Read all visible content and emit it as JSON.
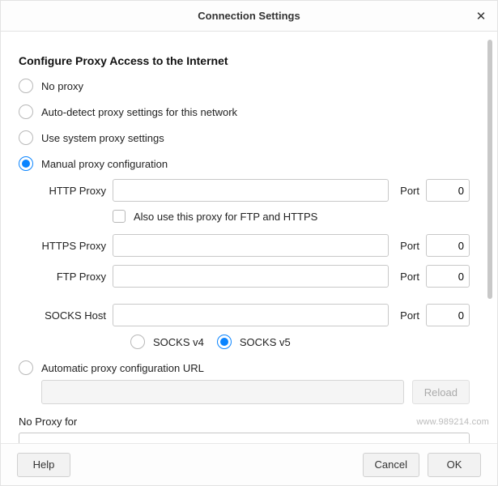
{
  "dialog": {
    "title": "Connection Settings",
    "close_glyph": "✕"
  },
  "heading": "Configure Proxy Access to the Internet",
  "proxy_mode": "manual",
  "options": {
    "no_proxy": "No proxy",
    "auto_detect": "Auto-detect proxy settings for this network",
    "system": "Use system proxy settings",
    "manual": "Manual proxy configuration",
    "auto_url": "Automatic proxy configuration URL"
  },
  "manual": {
    "http": {
      "label": "HTTP Proxy",
      "host": "",
      "port_label": "Port",
      "port": "0"
    },
    "shared_checkbox": {
      "checked": false,
      "label": "Also use this proxy for FTP and HTTPS"
    },
    "https": {
      "label": "HTTPS Proxy",
      "host": "",
      "port_label": "Port",
      "port": "0"
    },
    "ftp": {
      "label": "FTP Proxy",
      "host": "",
      "port_label": "Port",
      "port": "0"
    },
    "socks": {
      "label": "SOCKS Host",
      "host": "",
      "port_label": "Port",
      "port": "0"
    },
    "socks_version": {
      "selected": "v5",
      "v4_label": "SOCKS v4",
      "v5_label": "SOCKS v5"
    }
  },
  "auto_url": {
    "value": "",
    "reload_label": "Reload",
    "reload_enabled": false
  },
  "no_proxy_for": {
    "label": "No Proxy for",
    "value": ""
  },
  "footer": {
    "help": "Help",
    "cancel": "Cancel",
    "ok": "OK"
  },
  "watermark": "www.989214.com"
}
